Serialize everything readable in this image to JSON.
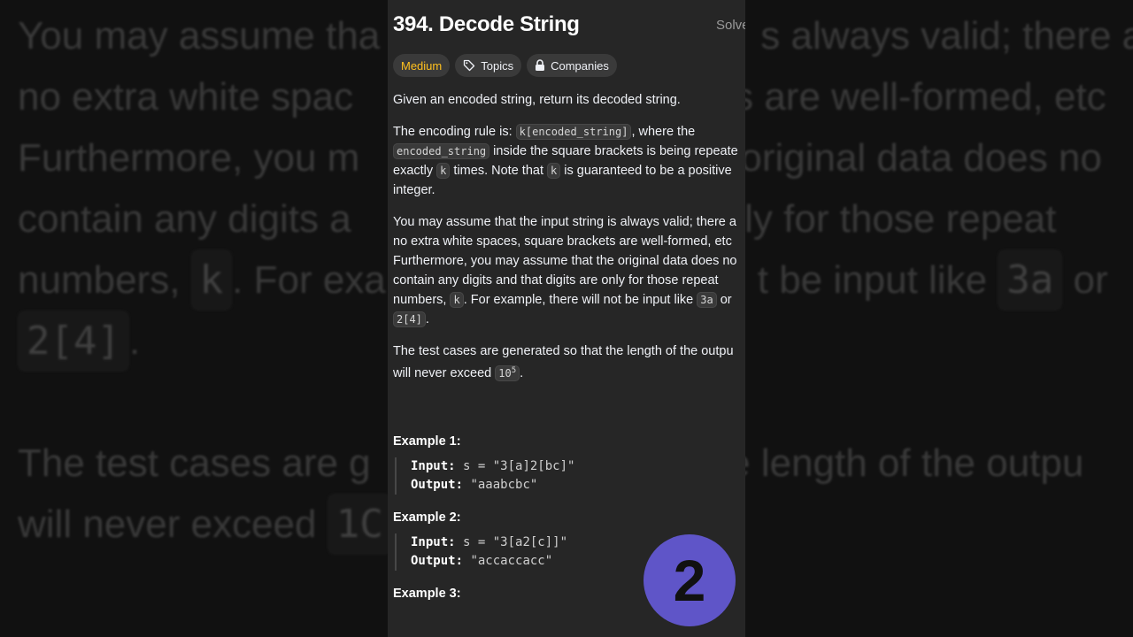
{
  "problem": {
    "title": "394. Decode String",
    "solved_label": "Solve",
    "tags": [
      {
        "label": "Medium",
        "icon": ""
      },
      {
        "label": "Topics",
        "icon": "tag-icon"
      },
      {
        "label": "Companies",
        "icon": "lock-icon"
      }
    ]
  },
  "description": {
    "p1": "Given an encoded string, return its decoded string.",
    "p2": {
      "a": "The encoding rule is: ",
      "code1": "k[encoded_string]",
      "b": ", where the",
      "code2": "encoded_string",
      "c": " inside the square brackets is being repeate",
      "d": "exactly ",
      "code3": "k",
      "e": " times. Note that ",
      "code4": "k",
      "f": " is guaranteed to be a positive",
      "g": "integer."
    },
    "p3": {
      "l1": "You may assume that the input string is always valid; there a",
      "l2": "no extra white spaces, square brackets are well-formed, etc",
      "l3": "Furthermore, you may assume that the original data does no",
      "l4": "contain any digits and that digits are only for those repeat",
      "l5a": "numbers, ",
      "l5code": "k",
      "l5b": ". For example, there will not be input like ",
      "l5code2": "3a",
      "l5c": " or",
      "l6code": "2[4]",
      "l6b": "."
    },
    "p4": {
      "l1": "The test cases are generated so that the length of the outpu",
      "l2a": "will never exceed ",
      "code": "10",
      "sup": "5",
      "l2b": "."
    }
  },
  "examples": [
    {
      "title": "Example 1:",
      "input_label": "Input:",
      "input": "s = \"3[a]2[bc]\"",
      "output_label": "Output:",
      "output": "\"aaabcbc\""
    },
    {
      "title": "Example 2:",
      "input_label": "Input:",
      "input": "s = \"3[a2[c]]\"",
      "output_label": "Output:",
      "output": "\"accaccacc\""
    },
    {
      "title": "Example 3:"
    }
  ],
  "overlay": {
    "badge_number": "2"
  },
  "backdrop": {
    "l1": "You may assume tha",
    "l1b": "s always valid; there a",
    "l2": "no extra white spac",
    "l2b": "s are well-formed, etc",
    "l3": "Furthermore, you m",
    "l3b": "original data does no",
    "l4": "contain any digits a",
    "l4b": "nly for those repeat",
    "l5": "numbers, ",
    "l5code": "k",
    "l5b": ". For exa",
    "l5c": "t be input like ",
    "l5code2": "3a",
    "l5d": " or",
    "l6code": "2[4]",
    "l6b": ".",
    "l7": "The test cases are g",
    "l7b": "he length of the outpu",
    "l8": "will never exceed ",
    "l8code": "1C"
  },
  "colors": {
    "panel_bg": "#262626",
    "medium_tag": "#ffc01e",
    "badge": "#5f55c8"
  }
}
